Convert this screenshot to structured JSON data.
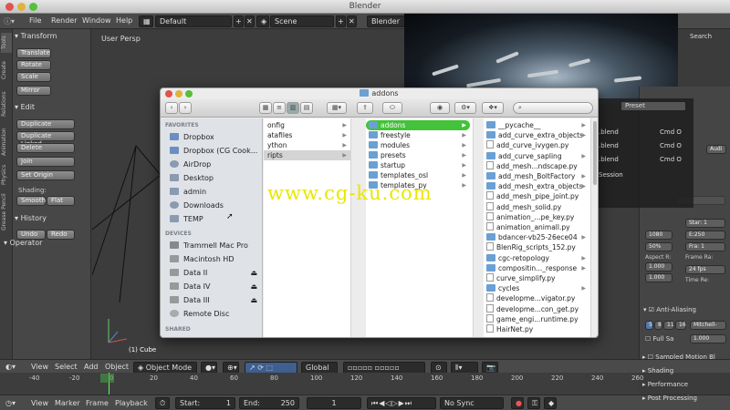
{
  "window": {
    "title": "Blender"
  },
  "menubar": {
    "items": [
      "File",
      "Render",
      "Window",
      "Help"
    ],
    "layout": "Default",
    "scene": "Scene",
    "engine": "Blender Re"
  },
  "sidetabs": [
    "Tools",
    "Create",
    "Relations",
    "Animation",
    "Physics",
    "Grease Pencil"
  ],
  "toolshelf": {
    "transform_title": "Transform",
    "transform": [
      "Translate",
      "Rotate",
      "Scale",
      "Mirror"
    ],
    "edit_title": "Edit",
    "edit": [
      "Duplicate",
      "Duplicate Linked",
      "Delete",
      "Join",
      "Set Origin"
    ],
    "shading_label": "Shading:",
    "smooth": "Smooth",
    "flat": "Flat",
    "history_title": "History",
    "undo": "Undo",
    "redo": "Redo",
    "operator_title": "Operator"
  },
  "viewport": {
    "label": "User Persp",
    "object": "(1) Cube",
    "search": "Search"
  },
  "overlay": {
    "preset": "Preset",
    "files": [
      ".blend",
      ".blend",
      ".blend"
    ],
    "shortcuts": [
      "Cmd O",
      "Cmd O",
      "Cmd O"
    ],
    "session": "Session"
  },
  "finder": {
    "title": "addons",
    "search_placeholder": "",
    "favorites_head": "FAVORITES",
    "favorites": [
      "Dropbox",
      "Dropbox (CG Cook...",
      "AirDrop",
      "Desktop",
      "admin",
      "Downloads",
      "TEMP"
    ],
    "devices_head": "DEVICES",
    "devices": [
      "Trammell Mac Pro",
      "Macintosh HD",
      "Data II",
      "Data IV",
      "Data III",
      "Remote Disc"
    ],
    "shared_head": "SHARED",
    "col1": [
      "onfig",
      "atafiles",
      "ython",
      "ripts"
    ],
    "col2": [
      "addons",
      "freestyle",
      "modules",
      "presets",
      "startup",
      "templates_osl",
      "templates_py"
    ],
    "col3": [
      "__pycache__",
      "add_curve_extra_objects",
      "add_curve_ivygen.py",
      "add_curve_sapling",
      "add_mesh...ndscape.py",
      "add_mesh_BoltFactory",
      "add_mesh_extra_objects",
      "add_mesh_pipe_joint.py",
      "add_mesh_solid.py",
      "animation_...pe_key.py",
      "animation_animall.py",
      "bdancer-vb25-26ece04",
      "BlenRig_scripts_152.py",
      "cgc-retopology",
      "compositin..._response",
      "curve_simplify.py",
      "cycles",
      "developme...vigator.py",
      "developme...con_get.py",
      "game_engi...runtime.py",
      "HairNet.py"
    ]
  },
  "rightpanel": {
    "audio": "Audi",
    "res_x": "1080",
    "res_pct": "50%",
    "start": "Star: 1",
    "end": "E:250",
    "frame": "Fra: 1",
    "aspect": "Aspect R:",
    "frame_rate": "Frame Ra:",
    "fps": "24 fps",
    "time_re": "Time Re:",
    "anti_aliasing": "Anti-Aliasing",
    "aa_values": [
      "5",
      "8",
      "11",
      "16"
    ],
    "filter": "Mitchell-",
    "full_sample": "Full Sa",
    "filter_size": "1.000",
    "motion_blur": "Sampled Motion Bl",
    "shading": "Shading",
    "performance": "Performance",
    "post_processing": "Post Processing",
    "val_1000": "1.000",
    "val_1000b": "1.000"
  },
  "timeline_header": {
    "items": [
      "View",
      "Select",
      "Add",
      "Object"
    ],
    "mode": "Object Mode",
    "orientation": "Global"
  },
  "ruler": {
    "ticks": [
      "-40",
      "-20",
      "0",
      "20",
      "40",
      "60",
      "80",
      "100",
      "120",
      "140",
      "160",
      "180",
      "200",
      "220",
      "240",
      "260"
    ]
  },
  "bottombar": {
    "items": [
      "View",
      "Marker",
      "Frame",
      "Playback"
    ],
    "start": "Start:",
    "start_val": "1",
    "end": "End:",
    "end_val": "250",
    "current": "1",
    "sync": "No Sync"
  },
  "watermark": "www.cg-ku.com",
  "colors": {
    "accent_green": "#44c23a",
    "finder_bg": "#ececec",
    "blender_bg": "#3c3c3c"
  }
}
